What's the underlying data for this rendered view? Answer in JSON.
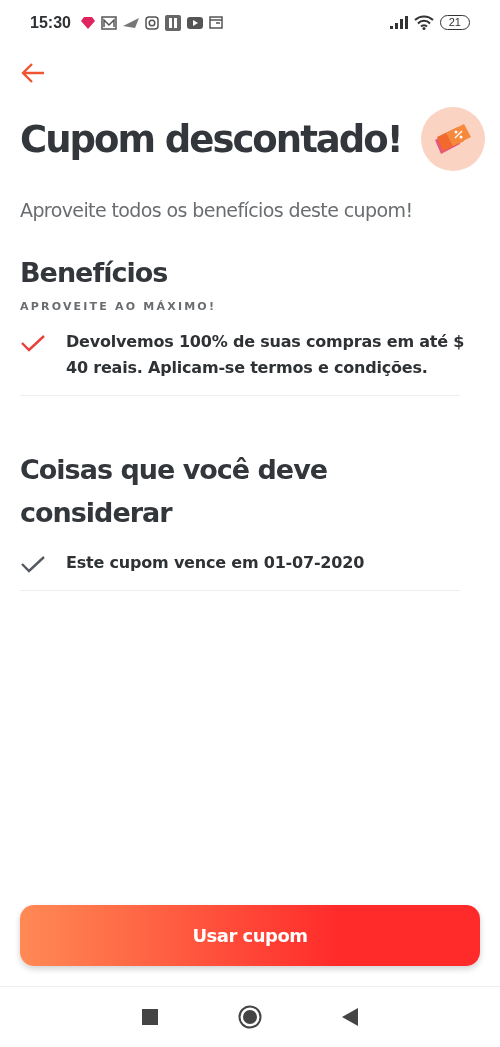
{
  "status_bar": {
    "time": "15:30",
    "battery": "21"
  },
  "header": {
    "title": "Cupom descontado!",
    "subtitle": "Aproveite todos os benefícios deste cupom!"
  },
  "sections": [
    {
      "title": "Benefícios",
      "subtitle": "APROVEITE AO MÁXIMO!",
      "items": [
        {
          "text": "Devolvemos 100% de suas compras em até $ 40 reais. Aplicam-se termos e condições.",
          "color": "#e8413c"
        }
      ]
    },
    {
      "title": "Coisas que você deve considerar",
      "items": [
        {
          "text": "Este cupom vence em  01-07-2020",
          "color": "#555a60"
        }
      ]
    }
  ],
  "button": {
    "label": "Usar cupom"
  }
}
